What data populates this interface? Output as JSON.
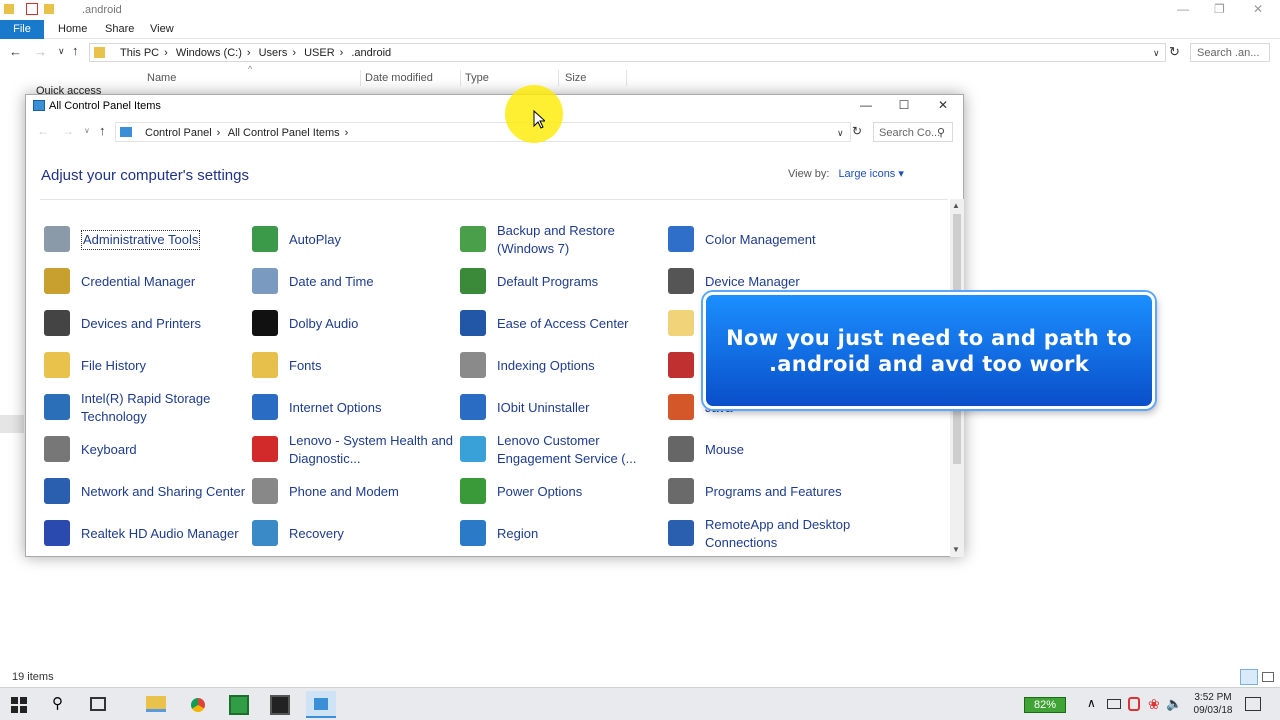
{
  "explorer": {
    "title": ".android",
    "ribbon_tabs": [
      "File",
      "Home",
      "Share",
      "View"
    ],
    "breadcrumb": [
      "This PC",
      "Windows (C:)",
      "Users",
      "USER",
      ".android"
    ],
    "search_placeholder": "Search .an...",
    "columns": [
      "Name",
      "Date modified",
      "Type",
      "Size"
    ],
    "quick_access": "Quick access",
    "status": "19 items"
  },
  "control_panel": {
    "title": "All Control Panel Items",
    "breadcrumb": [
      "Control Panel",
      "All Control Panel Items"
    ],
    "search_placeholder": "Search Co...",
    "heading": "Adjust your computer's settings",
    "view_by_label": "View by:",
    "view_by_value": "Large icons",
    "items": [
      {
        "label": "Administrative Tools",
        "icon": "admin-tools-icon",
        "color": "#8a9aa8"
      },
      {
        "label": "AutoPlay",
        "icon": "autoplay-icon",
        "color": "#3a9a4a"
      },
      {
        "label": "Backup and Restore (Windows 7)",
        "icon": "backup-icon",
        "color": "#4aa04a"
      },
      {
        "label": "Color Management",
        "icon": "color-management-icon",
        "color": "#2f6fc9"
      },
      {
        "label": "Credential Manager",
        "icon": "credential-icon",
        "color": "#c8a030"
      },
      {
        "label": "Date and Time",
        "icon": "clock-icon",
        "color": "#7a9ac0"
      },
      {
        "label": "Default Programs",
        "icon": "default-programs-icon",
        "color": "#3a8a3a"
      },
      {
        "label": "Device Manager",
        "icon": "device-manager-icon",
        "color": "#555555"
      },
      {
        "label": "Devices and Printers",
        "icon": "printer-icon",
        "color": "#444444"
      },
      {
        "label": "Dolby Audio",
        "icon": "dolby-icon",
        "color": "#111111"
      },
      {
        "label": "Ease of Access Center",
        "icon": "ease-access-icon",
        "color": "#2257a8"
      },
      {
        "label": "",
        "icon": "folder-icon",
        "color": "#f1d47a"
      },
      {
        "label": "File History",
        "icon": "file-history-icon",
        "color": "#e8c24a"
      },
      {
        "label": "Fonts",
        "icon": "fonts-icon",
        "color": "#e6c04a"
      },
      {
        "label": "Indexing Options",
        "icon": "indexing-icon",
        "color": "#8a8a8a"
      },
      {
        "label": "",
        "icon": "firewall-icon",
        "color": "#c03030"
      },
      {
        "label": "Intel(R) Rapid Storage Technology",
        "icon": "intel-rst-icon",
        "color": "#2b6fb8"
      },
      {
        "label": "Internet Options",
        "icon": "internet-options-icon",
        "color": "#2a6cc4"
      },
      {
        "label": "IObit Uninstaller",
        "icon": "iobit-icon",
        "color": "#2a6cc4"
      },
      {
        "label": "Java",
        "icon": "java-icon",
        "color": "#d4572a"
      },
      {
        "label": "Keyboard",
        "icon": "keyboard-icon",
        "color": "#777777"
      },
      {
        "label": "Lenovo - System Health and Diagnostic...",
        "icon": "lenovo-health-icon",
        "color": "#d22a2a"
      },
      {
        "label": "Lenovo Customer Engagement Service (...",
        "icon": "lenovo-engagement-icon",
        "color": "#3aa0d8"
      },
      {
        "label": "Mouse",
        "icon": "mouse-icon",
        "color": "#666666"
      },
      {
        "label": "Network and Sharing Center",
        "icon": "network-icon",
        "color": "#2a5fb0"
      },
      {
        "label": "Phone and Modem",
        "icon": "phone-icon",
        "color": "#888888"
      },
      {
        "label": "Power Options",
        "icon": "power-icon",
        "color": "#3a9a3a"
      },
      {
        "label": "Programs and Features",
        "icon": "programs-icon",
        "color": "#6a6a6a"
      },
      {
        "label": "Realtek HD Audio Manager",
        "icon": "realtek-icon",
        "color": "#2a4ab0"
      },
      {
        "label": "Recovery",
        "icon": "recovery-icon",
        "color": "#3a8ac8"
      },
      {
        "label": "Region",
        "icon": "region-icon",
        "color": "#2a7ac8"
      },
      {
        "label": "RemoteApp and Desktop Connections",
        "icon": "remoteapp-icon",
        "color": "#2a5fb0"
      }
    ]
  },
  "overlay": {
    "text": "Now you just need to and path to .android and avd too work"
  },
  "taskbar": {
    "battery": "82%",
    "time": "3:52 PM",
    "date": "09/03/18"
  }
}
